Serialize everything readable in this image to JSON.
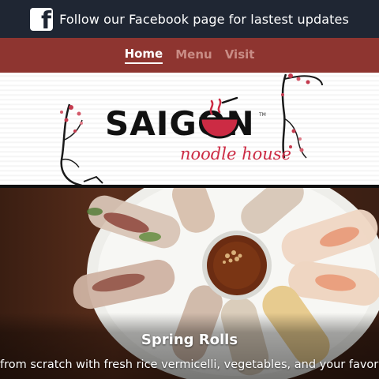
{
  "facebook_bar": {
    "text": "Follow our Facebook page for lastest updates",
    "icon": "facebook-icon"
  },
  "nav": {
    "items": [
      {
        "label": "Home",
        "active": true
      },
      {
        "label": "Menu",
        "active": false
      },
      {
        "label": "Visit",
        "active": false
      }
    ]
  },
  "header": {
    "logo_word": "SAIGON",
    "logo_sub": "noodle house",
    "trademark": "TM"
  },
  "hero": {
    "title": "Spring Rolls",
    "description": "from scratch with fresh rice vermicelli, vegetables, and your favorite p"
  },
  "colors": {
    "top_bar": "#1f2633",
    "nav_bar": "#8e3530",
    "accent_red": "#cc2b44"
  }
}
